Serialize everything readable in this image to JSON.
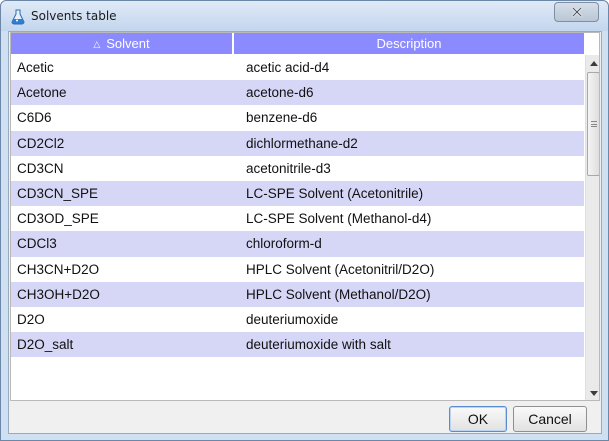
{
  "window": {
    "title": "Solvents table",
    "close_symbol": "X"
  },
  "table": {
    "columns": [
      {
        "label": "Solvent",
        "sort_indicator": "△"
      },
      {
        "label": "Description"
      }
    ],
    "rows": [
      {
        "solvent": "Acetic",
        "description": "acetic acid-d4"
      },
      {
        "solvent": "Acetone",
        "description": "acetone-d6"
      },
      {
        "solvent": "C6D6",
        "description": "benzene-d6"
      },
      {
        "solvent": "CD2Cl2",
        "description": "dichlormethane-d2"
      },
      {
        "solvent": "CD3CN",
        "description": "acetonitrile-d3"
      },
      {
        "solvent": "CD3CN_SPE",
        "description": "LC-SPE Solvent (Acetonitrile)"
      },
      {
        "solvent": "CD3OD_SPE",
        "description": "LC-SPE Solvent (Methanol-d4)"
      },
      {
        "solvent": "CDCl3",
        "description": "chloroform-d"
      },
      {
        "solvent": "CH3CN+D2O",
        "description": "HPLC Solvent (Acetonitril/D2O)"
      },
      {
        "solvent": "CH3OH+D2O",
        "description": "HPLC Solvent (Methanol/D2O)"
      },
      {
        "solvent": "D2O",
        "description": "deuteriumoxide"
      },
      {
        "solvent": "D2O_salt",
        "description": "deuteriumoxide with salt"
      }
    ],
    "row_colors": {
      "alternate": "#d6d6f6",
      "header": "#8b8bff"
    }
  },
  "buttons": {
    "ok_label": "OK",
    "cancel_label": "Cancel"
  },
  "icons": {
    "app": "solvent-flask-icon",
    "close": "close-icon",
    "scroll_up": "scroll-up-arrow-icon",
    "scroll_down": "scroll-down-arrow-icon"
  }
}
